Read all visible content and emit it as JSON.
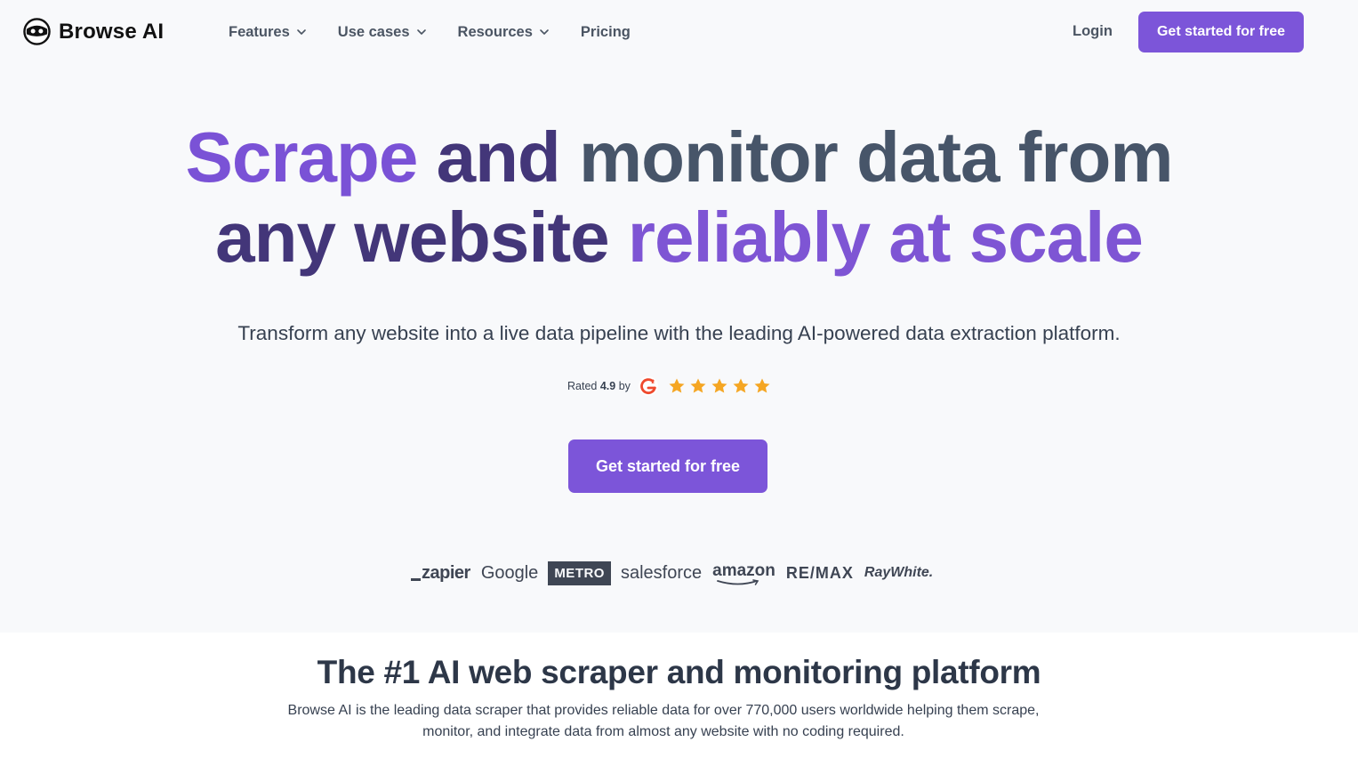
{
  "brand": {
    "name": "Browse AI"
  },
  "nav": {
    "items": [
      {
        "label": "Features",
        "has_dropdown": true
      },
      {
        "label": "Use cases",
        "has_dropdown": true
      },
      {
        "label": "Resources",
        "has_dropdown": true
      },
      {
        "label": "Pricing",
        "has_dropdown": false
      }
    ],
    "login": "Login",
    "cta": "Get started for free"
  },
  "hero": {
    "line1": {
      "part1": "Scrape",
      "part2": " and",
      "part3": " monitor data from"
    },
    "line2": {
      "part1": "any website",
      "part2": " reliably",
      "part3": " at scale"
    },
    "subtitle": "Transform any website into a live data pipeline with the leading AI-powered data extraction platform.",
    "rating": {
      "prefix": "Rated ",
      "value": "4.9",
      "suffix": " by",
      "stars": 5
    },
    "cta": "Get started for free"
  },
  "logos": [
    "zapier",
    "Google",
    "METRO",
    "salesforce",
    "amazon",
    "RE/MAX",
    "RayWhite."
  ],
  "section2": {
    "title": "The #1 AI web scraper and monitoring platform",
    "description": "Browse AI is the leading data scraper that provides reliable data for over 770,000 users worldwide helping them scrape, monitor, and integrate data from almost any website with no coding required."
  },
  "colors": {
    "accent": "#7c55d9",
    "star": "#f5a623",
    "g2": "#ef4a2e",
    "heading_dark": "#2d3748"
  }
}
